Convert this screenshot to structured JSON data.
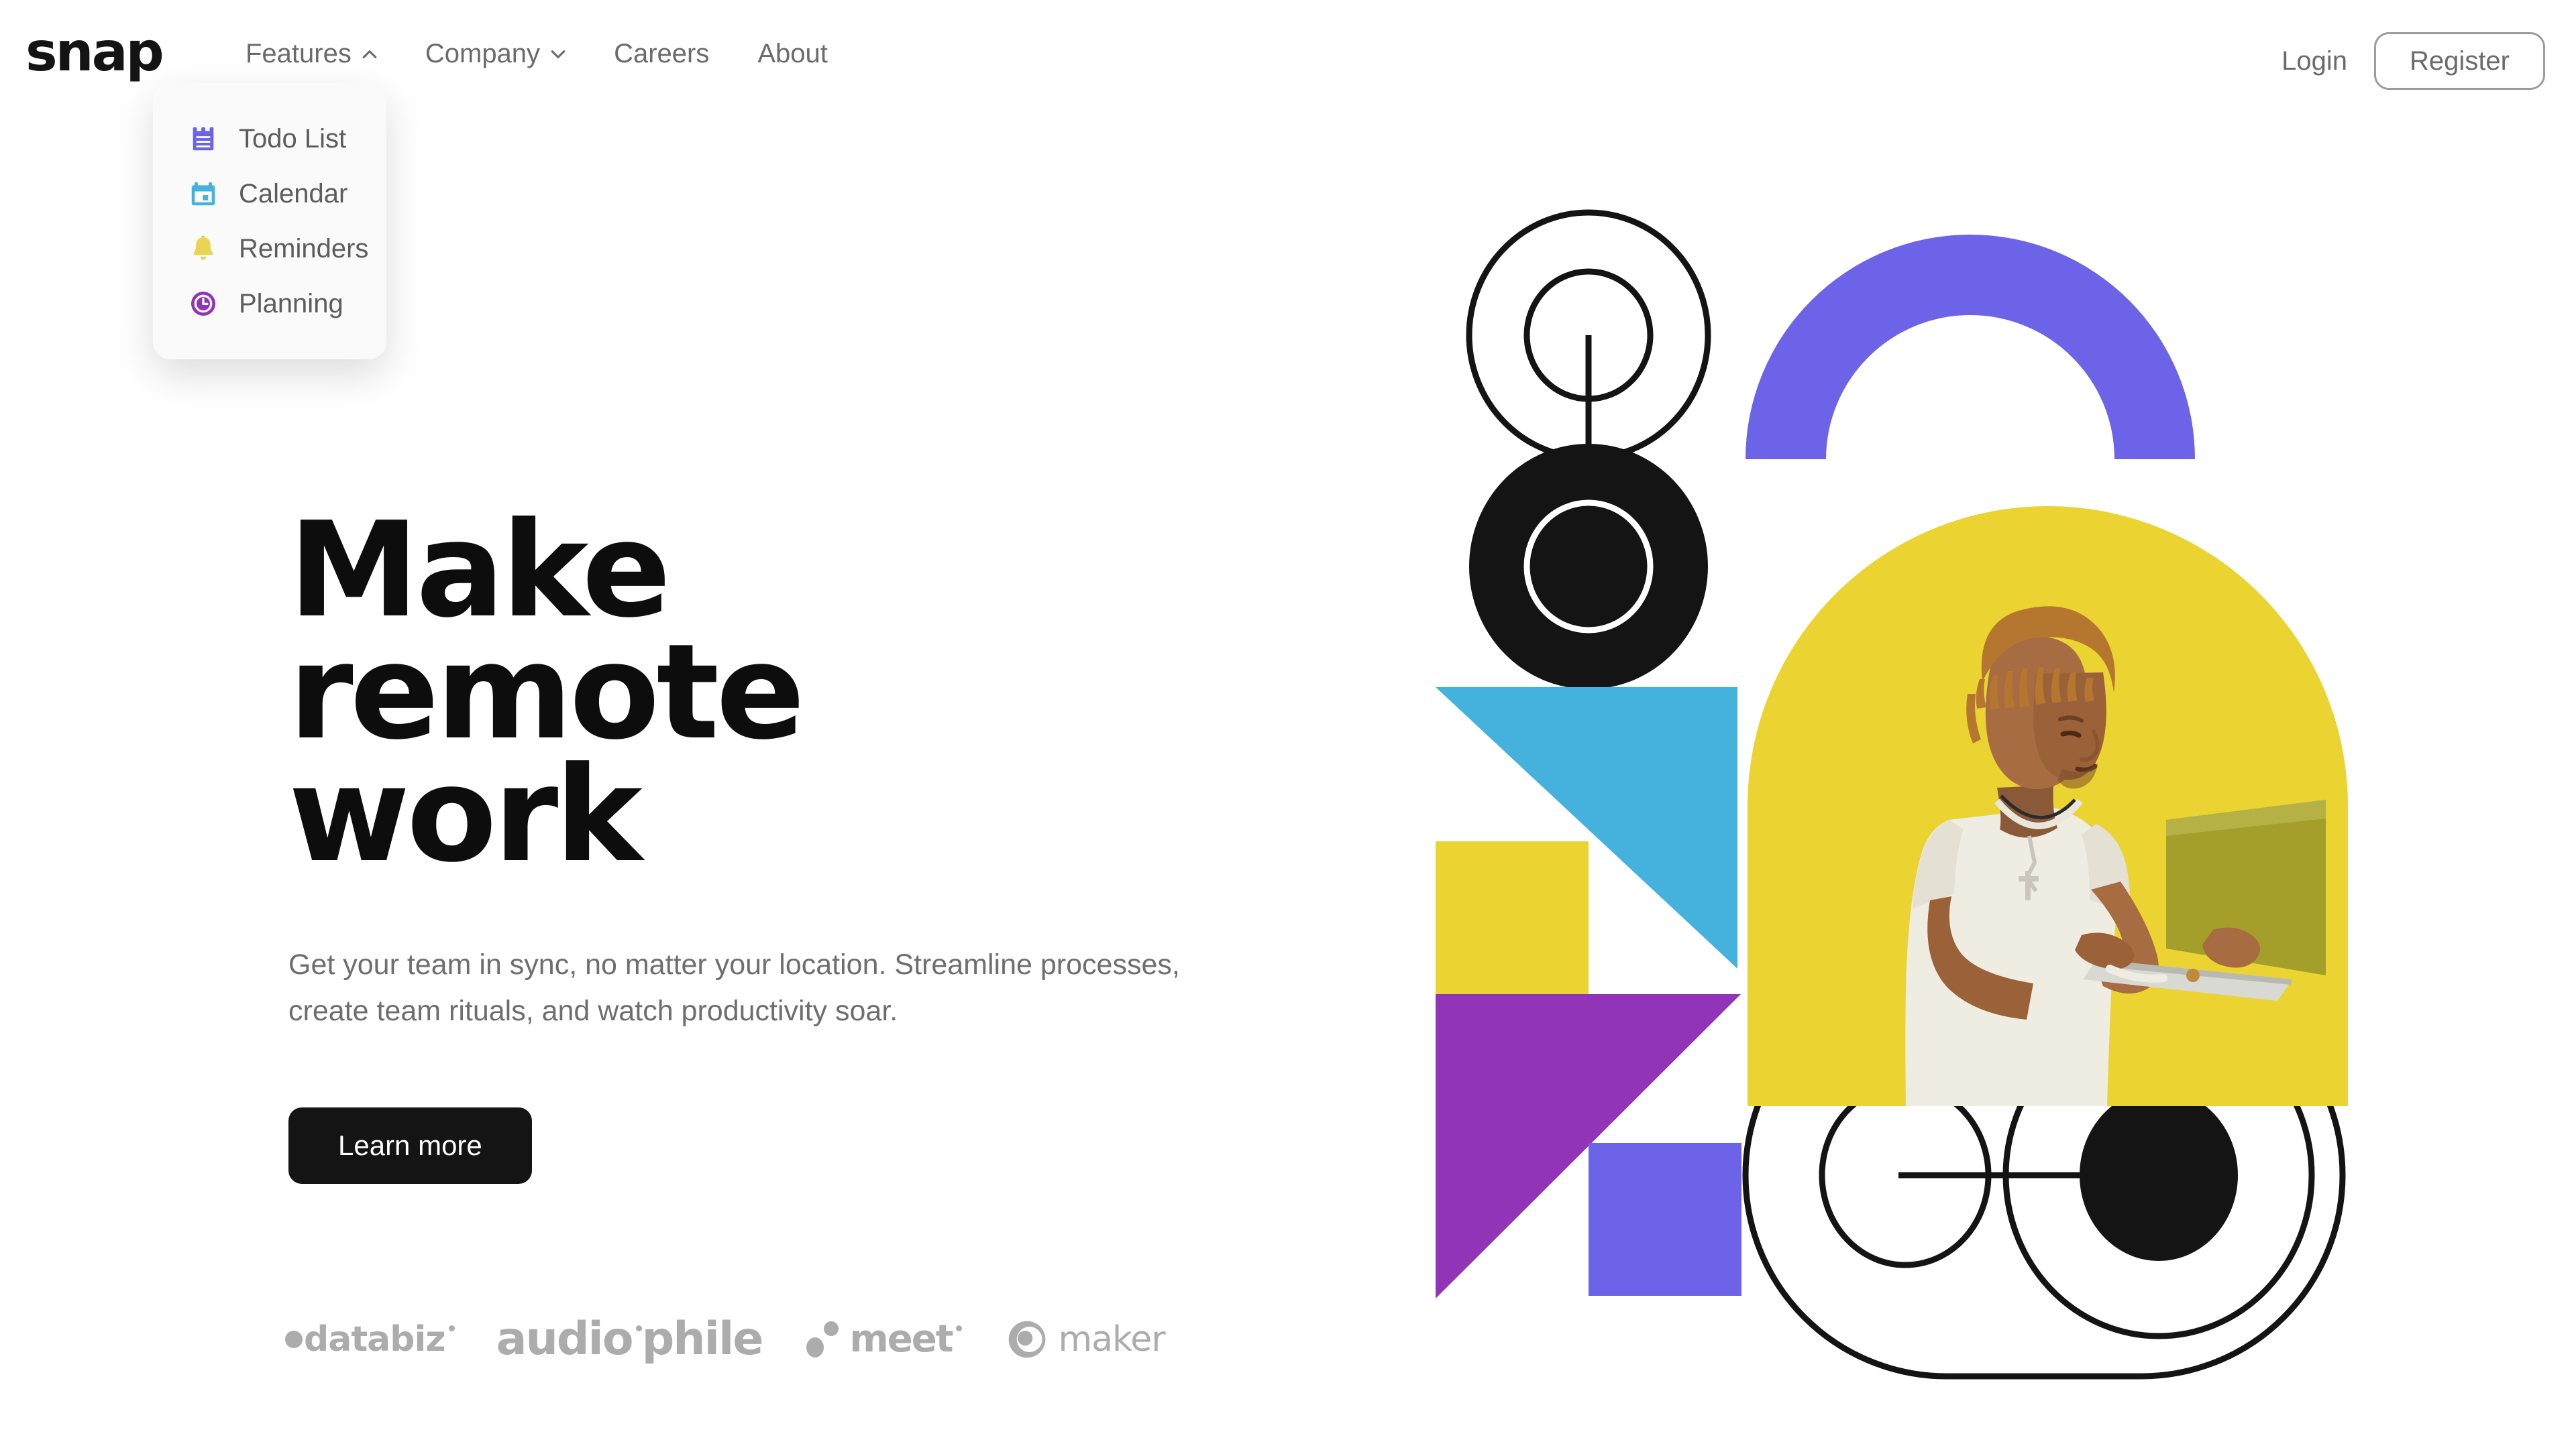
{
  "brand": {
    "logo_text": "snap"
  },
  "nav": {
    "links": [
      {
        "label": "Features",
        "icon": "chevron-up-icon",
        "has_chevron": true,
        "expanded": true
      },
      {
        "label": "Company",
        "icon": "chevron-down-icon",
        "has_chevron": true,
        "expanded": false
      },
      {
        "label": "Careers",
        "has_chevron": false
      },
      {
        "label": "About",
        "has_chevron": false
      }
    ],
    "login_label": "Login",
    "register_label": "Register"
  },
  "features_dropdown": {
    "open": true,
    "items": [
      {
        "label": "Todo List",
        "icon": "todo-list-icon",
        "color": "#6c63e8"
      },
      {
        "label": "Calendar",
        "icon": "calendar-icon",
        "color": "#45b2dd"
      },
      {
        "label": "Reminders",
        "icon": "bell-icon",
        "color": "#ebd452"
      },
      {
        "label": "Planning",
        "icon": "clock-icon",
        "color": "#9234b8"
      }
    ]
  },
  "hero": {
    "headline": "Make remote work",
    "subcopy": "Get your team in sync, no matter your location. Streamline processes, create team rituals, and watch productivity soar.",
    "cta_label": "Learn more"
  },
  "clients": [
    {
      "name": "databiz",
      "text": "databiz"
    },
    {
      "name": "audiophile",
      "line1": "audio",
      "line2": "phile"
    },
    {
      "name": "meet",
      "text": "meet"
    },
    {
      "name": "maker",
      "text": "maker"
    }
  ],
  "colors": {
    "indigo": "#6c63e8",
    "yellow": "#ebd432",
    "cyan": "#45b2dd",
    "purple": "#9234b8",
    "black": "#141414",
    "muted_text": "#6b6b6b",
    "logo_grey": "#acacac"
  },
  "graphic": {
    "shapes": [
      "concentric-outline-circles",
      "vertical-stem-line",
      "filled-black-circle-with-white-ring",
      "indigo-arch",
      "yellow-photo-circle",
      "cyan-square-with-triangle-notch",
      "yellow-square",
      "purple-triangle",
      "indigo-square",
      "pill-outline-with-two-circles"
    ]
  }
}
